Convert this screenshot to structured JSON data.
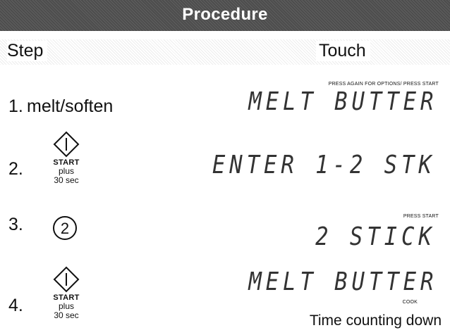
{
  "header": {
    "title": "Procedure"
  },
  "columns": {
    "step": "Step",
    "touch": "Touch"
  },
  "steps": [
    {
      "number": "1.",
      "label": "melt/soften",
      "hint": "PRESS AGAIN FOR OPTIONS/  PRESS START",
      "display": "MELT BUTTER"
    },
    {
      "number": "2.",
      "button": "START",
      "plus": "plus",
      "plus_time": "30 sec",
      "display": "ENTER 1-2 STK"
    },
    {
      "number": "3.",
      "key": "2",
      "hint": "PRESS START",
      "display": "2 STICK"
    },
    {
      "number": "4.",
      "button": "START",
      "plus": "plus",
      "plus_time": "30 sec",
      "display": "MELT BUTTER",
      "hint": "COOK",
      "status": "Time counting down"
    }
  ],
  "icons": {
    "start_button": "power-start-diamond-icon",
    "number_key": "circled-number-key"
  }
}
